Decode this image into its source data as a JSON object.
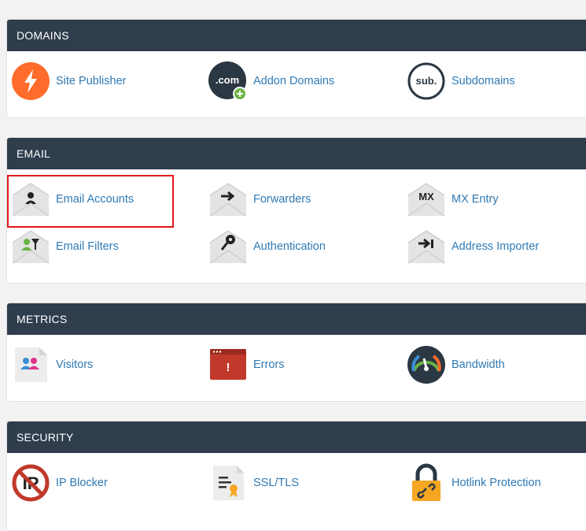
{
  "sections": [
    {
      "title": "DOMAINS",
      "items": [
        {
          "label": "Site Publisher",
          "icon": "bolt-icon"
        },
        {
          "label": "Addon Domains",
          "icon": "dotcom-add-icon"
        },
        {
          "label": "Subdomains",
          "icon": "sub-icon"
        }
      ]
    },
    {
      "title": "EMAIL",
      "items": [
        {
          "label": "Email Accounts",
          "icon": "envelope-person-icon"
        },
        {
          "label": "Forwarders",
          "icon": "envelope-arrow-icon"
        },
        {
          "label": "MX Entry",
          "icon": "envelope-mx-icon"
        },
        {
          "label": "Email Filters",
          "icon": "envelope-filter-icon"
        },
        {
          "label": "Authentication",
          "icon": "envelope-key-icon"
        },
        {
          "label": "Address Importer",
          "icon": "envelope-import-icon"
        }
      ]
    },
    {
      "title": "METRICS",
      "items": [
        {
          "label": "Visitors",
          "icon": "visitors-icon"
        },
        {
          "label": "Errors",
          "icon": "error-window-icon"
        },
        {
          "label": "Bandwidth",
          "icon": "gauge-icon"
        }
      ]
    },
    {
      "title": "SECURITY",
      "items": [
        {
          "label": "IP Blocker",
          "icon": "ip-block-icon"
        },
        {
          "label": "SSL/TLS",
          "icon": "certificate-icon"
        },
        {
          "label": "Hotlink Protection",
          "icon": "padlock-link-icon"
        }
      ]
    }
  ],
  "badge_text": {
    "com": ".com",
    "sub": "sub.",
    "mx": "MX",
    "ip": "IP",
    "error_mark": "!"
  },
  "colors": {
    "header": "#2f3d4d",
    "link": "#2f7ab5",
    "highlight": "#e0181e",
    "orange": "#ff6c2c"
  }
}
